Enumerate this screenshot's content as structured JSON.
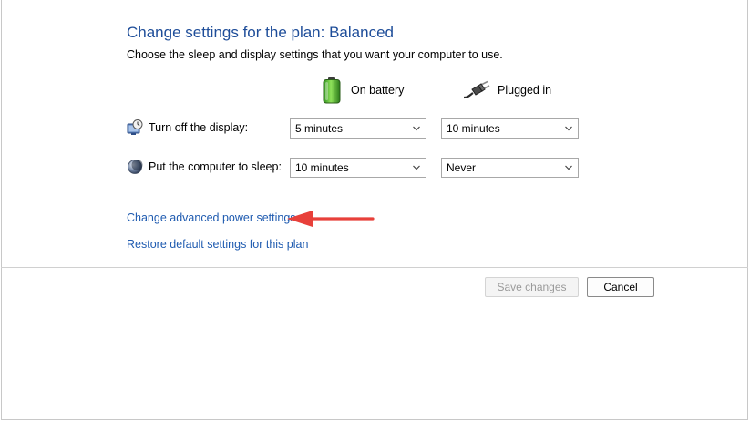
{
  "page": {
    "title": "Change settings for the plan: Balanced",
    "subtitle": "Choose the sleep and display settings that you want your computer to use."
  },
  "columns": {
    "battery": {
      "label": "On battery",
      "icon": "battery-icon"
    },
    "plugged": {
      "label": "Plugged in",
      "icon": "power-plug-icon"
    }
  },
  "settings": [
    {
      "label": "Turn off the display:",
      "icon": "monitor-clock-icon",
      "on_battery": "5 minutes",
      "plugged_in": "10 minutes"
    },
    {
      "label": "Put the computer to sleep:",
      "icon": "moon-sleep-icon",
      "on_battery": "10 minutes",
      "plugged_in": "Never"
    }
  ],
  "links": {
    "advanced": "Change advanced power settings",
    "restore": "Restore default settings for this plan"
  },
  "buttons": {
    "save": "Save changes",
    "save_enabled": false,
    "cancel": "Cancel"
  },
  "annotation": {
    "arrow_color": "#e8403a",
    "points_to": "links.advanced"
  },
  "colors": {
    "title": "#1e4d99",
    "link": "#1f5bb0"
  }
}
